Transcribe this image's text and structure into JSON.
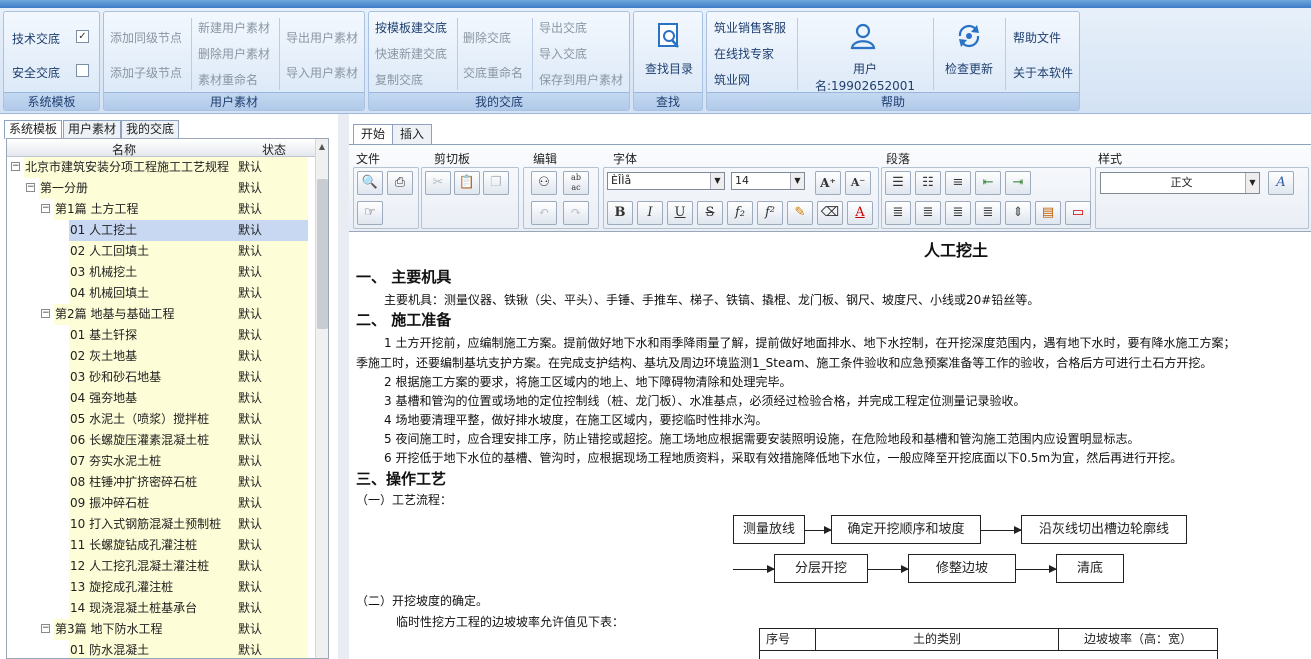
{
  "ribbon": {
    "groups": {
      "system_template": {
        "label": "系统模板",
        "tech_exchange": {
          "label": "技术交底",
          "checked": true
        },
        "safety_exchange": {
          "label": "安全交底",
          "checked": false
        }
      },
      "user_material": {
        "label": "用户素材",
        "add_sibling": "添加同级节点",
        "add_child": "添加子级节点",
        "new_material": "新建用户素材",
        "delete_material": "删除用户素材",
        "rename_material": "素材重命名",
        "export_material": "导出用户素材",
        "import_material": "导入用户素材"
      },
      "my_exchange": {
        "label": "我的交底",
        "build_by_template": "按模板建交底",
        "quick_new": "快速新建交底",
        "copy": "复制交底",
        "delete": "删除交底",
        "rename": "交底重命名",
        "export": "导出交底",
        "import": "导入交底",
        "save_to_material": "保存到用户素材"
      },
      "find": {
        "label": "查找",
        "find_catalog": "查找目录"
      },
      "help": {
        "label": "帮助",
        "sales_service": "筑业销售客服",
        "online_expert": "在线找专家",
        "zhuye_net": "筑业网",
        "username": "用户名:19902652001",
        "check_update": "检查更新",
        "help_file": "帮助文件",
        "about": "关于本软件"
      }
    }
  },
  "left": {
    "tabs": [
      "系统模板",
      "用户素材",
      "我的交底"
    ],
    "columns": {
      "name": "名称",
      "status": "状态"
    },
    "rows": [
      {
        "label": "北京市建筑安装分项工程施工工艺规程",
        "status": "默认",
        "level": 0,
        "toggle": "−"
      },
      {
        "label": "第一分册",
        "status": "默认",
        "level": 1,
        "toggle": "−"
      },
      {
        "label": "第1篇 土方工程",
        "status": "默认",
        "level": 2,
        "toggle": "−"
      },
      {
        "label": "01 人工挖土",
        "status": "默认",
        "level": 3,
        "selected": true
      },
      {
        "label": "02 人工回填土",
        "status": "默认",
        "level": 3
      },
      {
        "label": "03 机械挖土",
        "status": "默认",
        "level": 3
      },
      {
        "label": "04 机械回填土",
        "status": "默认",
        "level": 3
      },
      {
        "label": "第2篇 地基与基础工程",
        "status": "默认",
        "level": 2,
        "toggle": "−"
      },
      {
        "label": "01 基土钎探",
        "status": "默认",
        "level": 3
      },
      {
        "label": "02 灰土地基",
        "status": "默认",
        "level": 3
      },
      {
        "label": "03 砂和砂石地基",
        "status": "默认",
        "level": 3
      },
      {
        "label": "04 强夯地基",
        "status": "默认",
        "level": 3
      },
      {
        "label": "05 水泥土（喷浆）搅拌桩",
        "status": "默认",
        "level": 3
      },
      {
        "label": "06 长螺旋压灌素混凝土桩",
        "status": "默认",
        "level": 3
      },
      {
        "label": "07 夯实水泥土桩",
        "status": "默认",
        "level": 3
      },
      {
        "label": "08 柱锤冲扩挤密碎石桩",
        "status": "默认",
        "level": 3
      },
      {
        "label": "09 振冲碎石桩",
        "status": "默认",
        "level": 3
      },
      {
        "label": "10 打入式钢筋混凝土预制桩",
        "status": "默认",
        "level": 3
      },
      {
        "label": "11 长螺旋钻成孔灌注桩",
        "status": "默认",
        "level": 3
      },
      {
        "label": "12 人工挖孔混凝土灌注桩",
        "status": "默认",
        "level": 3
      },
      {
        "label": "13 旋挖成孔灌注桩",
        "status": "默认",
        "level": 3
      },
      {
        "label": "14 现浇混凝土桩基承台",
        "status": "默认",
        "level": 3
      },
      {
        "label": "第3篇 地下防水工程",
        "status": "默认",
        "level": 2,
        "toggle": "−"
      },
      {
        "label": "01 防水混凝土",
        "status": "默认",
        "level": 3
      }
    ]
  },
  "editor": {
    "tabs": [
      "开始",
      "插入"
    ],
    "sections": {
      "file": "文件",
      "clipboard": "剪切板",
      "edit": "编辑",
      "font": "字体",
      "paragraph": "段落",
      "style": "样式"
    },
    "font_name": "ÈÎÌå",
    "font_size": "14",
    "style_value": "正文",
    "buttons": {
      "bold": "B",
      "italic": "I",
      "underline": "U",
      "strike": "S",
      "sub": "f₂",
      "sup": "f²",
      "grow": "A⁺",
      "shrink": "A⁻",
      "replace_top": "ab",
      "replace_bottom": "ac"
    }
  },
  "document": {
    "title": "人工挖土",
    "s1": "一、  主要机具",
    "s1_p": "主要机具：测量仪器、铁锹（尖、平头）、手锤、手推车、梯子、铁镐、撬棍、龙门板、钢尺、坡度尺、小线或20#铅丝等。",
    "s2": "二、  施工准备",
    "p1a": "1  土方开挖前，应编制施工方案。提前做好地下水和雨季降雨量了解，提前做好地面排水、地下水控制，在开挖深度范围内，遇有地下水时，要有降水施工方案；",
    "p1b": "季施工时，还要编制基坑支护方案。在完成支护结构、基坑及周边环境监测1_Steam、施工条件验收和应急预案准备等工作的验收，合格后方可进行土石方开挖。",
    "p2": "2 根据施工方案的要求，将施工区域内的地上、地下障碍物清除和处理完毕。",
    "p3": "3 基槽和管沟的位置或场地的定位控制线（桩、龙门板）、水准基点，必须经过检验合格，并完成工程定位测量记录验收。",
    "p4": "4 场地要清理平整，做好排水坡度，在施工区域内，要挖临时性排水沟。",
    "p5": "5 夜间施工时，应合理安排工序，防止错挖或超挖。施工场地应根据需要安装照明设施，在危险地段和基槽和管沟施工范围内应设置明显标志。",
    "p6": "6 开挖低于地下水位的基槽、管沟时，应根据现场工程地质资料，采取有效措施降低地下水位，一般应降至开挖底面以下0.5m为宜，然后再进行开挖。",
    "s3": "三、操作工艺",
    "sub1": "（一）工艺流程：",
    "flow": [
      "测量放线",
      "确定开挖顺序和坡度",
      "沿灰线切出槽边轮廓线",
      "分层开挖",
      "修整边坡",
      "清底"
    ],
    "sub2": "（二）开挖坡度的确定。",
    "sub2_p": "临时性挖方工程的边坡坡率允许值见下表：",
    "table_headers": [
      "序号",
      "土的类别",
      "边坡坡率（高：宽）"
    ]
  }
}
